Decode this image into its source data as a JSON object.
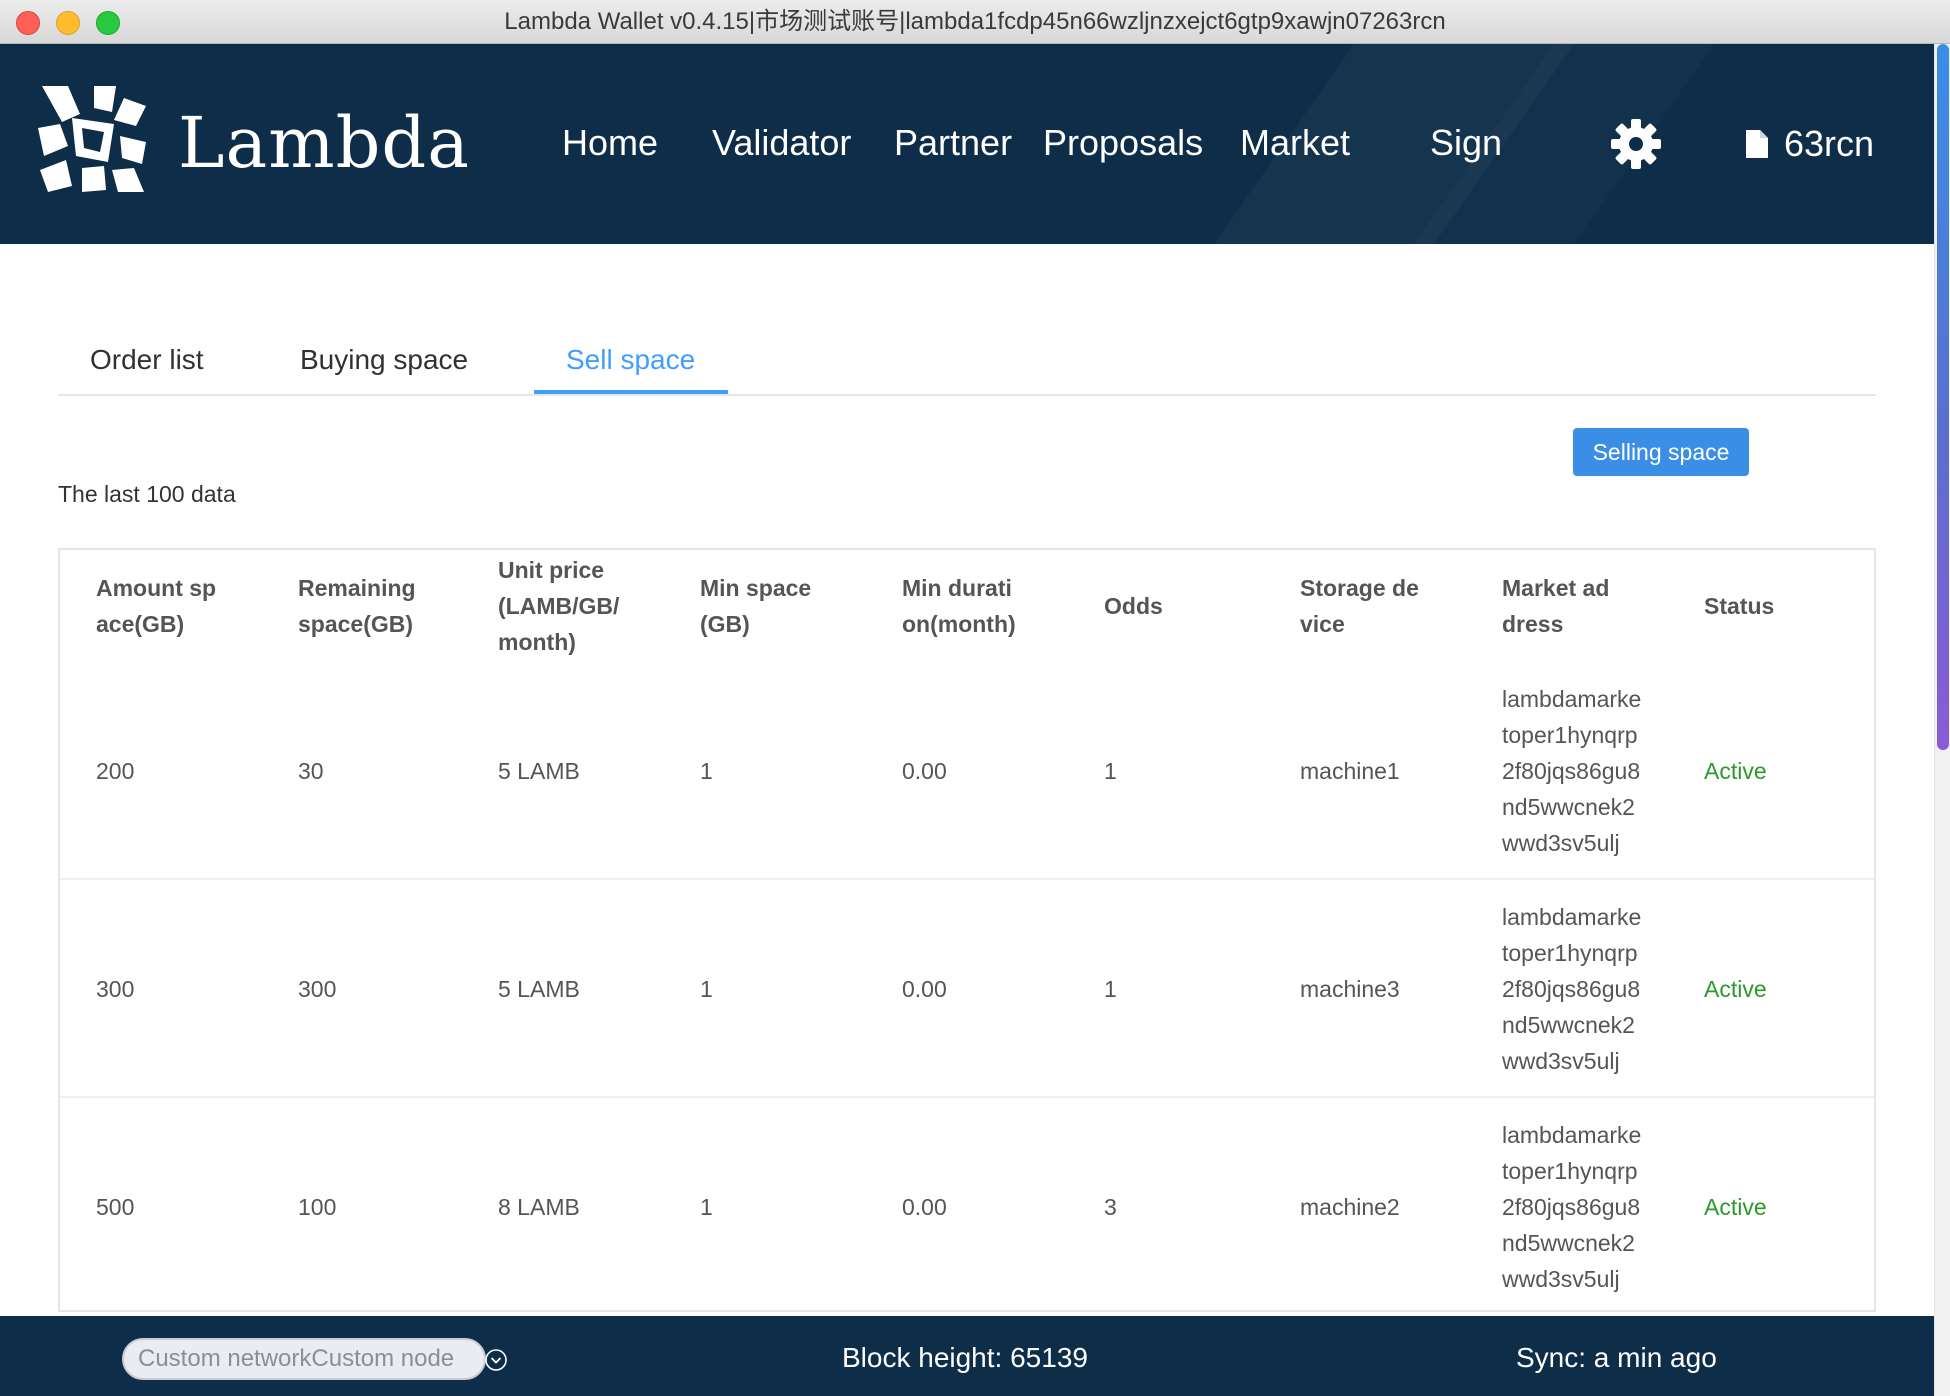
{
  "window": {
    "title": "Lambda Wallet v0.4.15|市场测试账号|lambda1fcdp45n66wzljnzxejct6gtp9xawjn07263rcn"
  },
  "header": {
    "logo_text": "Lambda",
    "nav": [
      "Home",
      "Validator",
      "Partner",
      "Proposals",
      "Market",
      "Sign"
    ],
    "settings_icon": "gear-icon",
    "account_icon": "document-icon",
    "account_label": "63rcn"
  },
  "tabs": [
    {
      "label": "Order list",
      "active": false
    },
    {
      "label": "Buying space",
      "active": false
    },
    {
      "label": "Sell space",
      "active": true
    }
  ],
  "actions": {
    "sell_button": "Selling space"
  },
  "info": {
    "last_data": "The last 100 data"
  },
  "table": {
    "headers": [
      [
        "Amount sp",
        "ace(GB)"
      ],
      [
        "Remaining",
        "space(GB)"
      ],
      [
        "Unit price",
        "(LAMB/GB/",
        "month)"
      ],
      [
        "Min space",
        "(GB)"
      ],
      [
        "Min durati",
        "on(month)"
      ],
      [
        "Odds"
      ],
      [
        "Storage de",
        "vice"
      ],
      [
        "Market ad",
        "dress"
      ],
      [
        "Status"
      ]
    ],
    "rows": [
      {
        "amount": "200",
        "remaining": "30",
        "price": "5 LAMB",
        "min_space": "1",
        "min_duration": "0.00",
        "odds": "1",
        "device": "machine1",
        "address": "lambdamarketoper1hynqrp2f80jqs86gu8nd5wwcnek2wwd3sv5ulj",
        "status": "Active"
      },
      {
        "amount": "300",
        "remaining": "300",
        "price": "5 LAMB",
        "min_space": "1",
        "min_duration": "0.00",
        "odds": "1",
        "device": "machine3",
        "address": "lambdamarketoper1hynqrp2f80jqs86gu8nd5wwcnek2wwd3sv5ulj",
        "status": "Active"
      },
      {
        "amount": "500",
        "remaining": "100",
        "price": "8 LAMB",
        "min_space": "1",
        "min_duration": "0.00",
        "odds": "3",
        "device": "machine2",
        "address": "lambdamarketoper1hynqrp2f80jqs86gu8nd5wwcnek2wwd3sv5ulj",
        "status": "Active"
      }
    ]
  },
  "footer": {
    "network_select": "Custom networkCustom node",
    "block_height": "Block height: 65139",
    "sync": "Sync: a min ago"
  },
  "colors": {
    "header_bg": "#0d2d48",
    "accent": "#409eff",
    "status_active": "#2a9a2a"
  }
}
